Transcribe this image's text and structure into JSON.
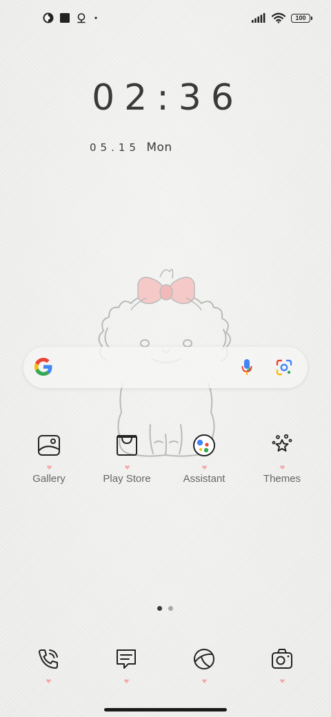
{
  "status_bar": {
    "left_icons": [
      "data-saver-icon",
      "square-notification-icon",
      "location-pin-icon",
      "dot-icon"
    ],
    "right_icons": [
      "signal-icon",
      "wifi-icon"
    ],
    "battery_level": "100"
  },
  "clock": {
    "time": "02:36",
    "date": "05.15",
    "weekday": "Mon"
  },
  "search": {
    "logo": "google-g-icon",
    "voice_icon": "mic-icon",
    "lens_icon": "google-lens-icon"
  },
  "apps": [
    {
      "label": "Gallery",
      "icon": "gallery-icon"
    },
    {
      "label": "Play Store",
      "icon": "play-store-icon"
    },
    {
      "label": "Assistant",
      "icon": "assistant-icon"
    },
    {
      "label": "Themes",
      "icon": "themes-icon"
    }
  ],
  "page_indicator": {
    "current": 1,
    "total": 2
  },
  "dock": [
    {
      "icon": "phone-icon"
    },
    {
      "icon": "messages-icon"
    },
    {
      "icon": "browser-icon"
    },
    {
      "icon": "camera-icon"
    }
  ],
  "colors": {
    "background": "#efefed",
    "dot_pink": "#f4a9a9",
    "bow_pink": "#f6c9c9",
    "text_dark": "#3a3a3a",
    "label_gray": "#666666"
  }
}
